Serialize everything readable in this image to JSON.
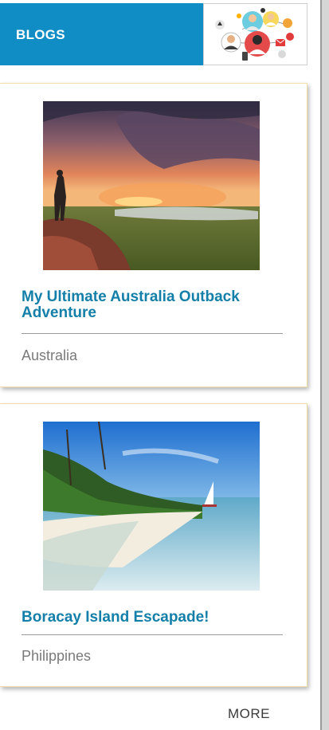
{
  "header": {
    "title": "BLOGS",
    "image_icon": "social-people-icon"
  },
  "posts": [
    {
      "title": "My Ultimate Australia Outback Adventure",
      "location": "Australia",
      "image_icon": "outback-sunset-photo"
    },
    {
      "title": "Boracay Island Escapade!",
      "location": "Philippines",
      "image_icon": "tropical-beach-photo"
    }
  ],
  "more_label": "MORE",
  "colors": {
    "header_bg": "#0f8dc4",
    "title_text": "#147fa8",
    "card_border": "#f0dfa5",
    "location_text": "#7a7a7a"
  }
}
